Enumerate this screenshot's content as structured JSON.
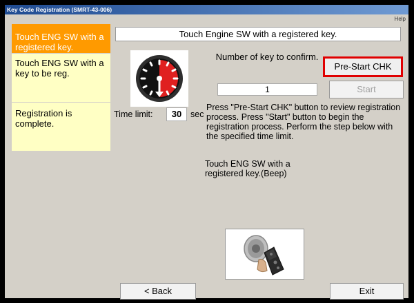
{
  "window": {
    "title": "Key Code Registration (SMRT-43-006)",
    "help_label": "Help"
  },
  "sidebar": {
    "steps": [
      {
        "label": "Touch ENG SW with a registered key."
      },
      {
        "label": "Touch ENG SW with a key to be reg."
      },
      {
        "label": "Registration is complete."
      }
    ]
  },
  "banner": {
    "text": "Touch Engine SW with a registered key."
  },
  "time_limit": {
    "label": "Time limit:",
    "value": "30",
    "unit": "sec"
  },
  "key_count": {
    "label": "Number of key to confirm.",
    "value": "1"
  },
  "buttons": {
    "prestart": "Pre-Start CHK",
    "start": "Start",
    "back": "< Back",
    "exit": "Exit"
  },
  "instructions": {
    "main": "Press \"Pre-Start CHK\" button to review registration process. Press \"Start\" button to begin the registration process. Perform the step below with the specified time limit.",
    "step": "Touch ENG SW with a registered key.(Beep)"
  },
  "icons": {
    "gauge": "countdown-timer-icon",
    "key": "smart-key-icon"
  },
  "colors": {
    "active_step": "#ff9a00",
    "step_bg": "#ffffc4",
    "highlight_border": "#e00000",
    "gauge_red": "#e02020"
  }
}
